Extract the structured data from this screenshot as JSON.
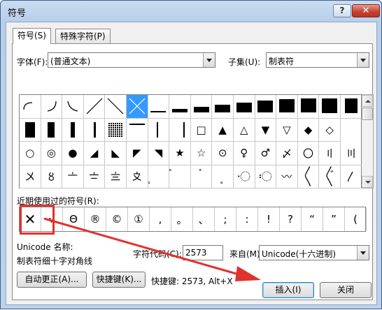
{
  "window": {
    "title": "符号",
    "help_glyph": "?",
    "close_glyph": "✕"
  },
  "tabs": [
    {
      "label": "符号(S)",
      "active": true
    },
    {
      "label": "特殊字符(P)",
      "active": false
    }
  ],
  "font": {
    "label": "字体(F):",
    "value": "(普通文本)"
  },
  "subset": {
    "label": "子集(U):",
    "value": "制表符"
  },
  "symbol_rows": [
    [
      "arc-ul",
      "arc-ur",
      "arc-ll",
      "diag-r",
      "diag-l",
      "diag-x",
      "bar1",
      "bar2",
      "bar3",
      "bar4",
      "bar5",
      "bar6",
      "bar7",
      "bar8",
      "bar9",
      "bar10"
    ],
    [
      "blk-l",
      "blk-m",
      "blk-r",
      "bar-v",
      "dots",
      "bar-top",
      "bar-mid",
      "bar-right",
      "□",
      "▲",
      "△",
      "▼",
      "▽",
      "◆",
      "◇"
    ],
    [
      "○",
      "◎",
      "●",
      "◢",
      "◣",
      "◤",
      "◥",
      "★",
      "☆",
      "⊙",
      "♀",
      "♂",
      "〆",
      "〇",
      "〢",
      "〣"
    ],
    [
      "〤",
      "〥",
      "〦",
      "〧",
      "〨",
      "〩",
      "〪",
      "〫",
      "〬",
      "〭",
      "〮",
      "〯",
      "〰",
      "〱",
      "〲",
      "〳"
    ]
  ],
  "recent": {
    "label": "近期使用过的符号(R):",
    "symbols": [
      "✕",
      "√",
      "Θ",
      "®",
      "©",
      "①",
      ",",
      "。",
      "、",
      ";",
      ":",
      "!",
      "?",
      "“",
      "”",
      "("
    ]
  },
  "unicode_name_label": "Unicode 名称:",
  "unicode_name_value": "制表符细十字对角线",
  "char_code": {
    "label": "字符代码(C):",
    "value": "2573"
  },
  "from": {
    "label": "来自(M):",
    "value": "Unicode(十六进制)"
  },
  "buttons": {
    "autocorrect": "自动更正(A)...",
    "shortcut_key": "快捷键(K)...",
    "insert": "插入(I)",
    "cancel": "关闭"
  },
  "shortcut_text": "快捷键: 2573, Alt+X",
  "colors": {
    "selection": "#3399ff",
    "highlight": "#e0322f"
  }
}
